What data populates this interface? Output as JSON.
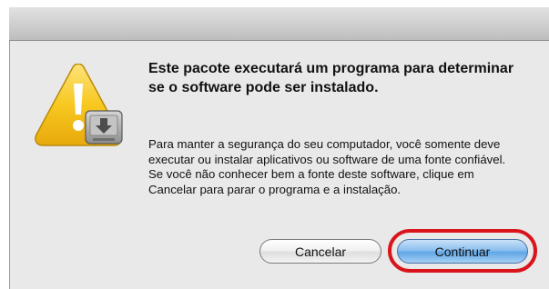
{
  "dialog": {
    "headline": "Este pacote executará um programa para determinar se o software pode ser instalado.",
    "message": "Para manter a segurança do seu computador, você somente deve executar ou instalar aplicativos ou software de uma fonte confiável. Se você não conhecer bem a fonte deste software, clique em Cancelar para parar o programa e a instalação.",
    "icon": "warning-installer-icon"
  },
  "buttons": {
    "cancel_label": "Cancelar",
    "continue_label": "Continuar"
  },
  "colors": {
    "highlight": "#d9141c",
    "warning_yellow": "#f5c518",
    "default_button": "#5fa6e6"
  }
}
